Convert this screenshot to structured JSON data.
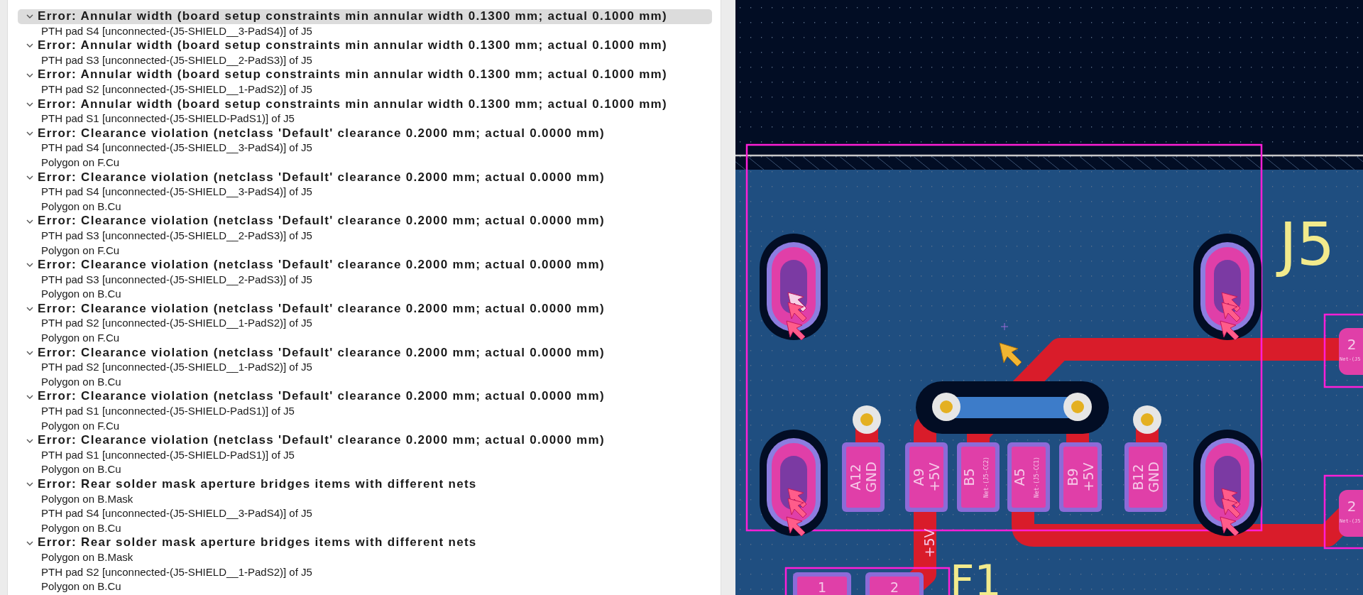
{
  "violations": [
    {
      "title": "Error: Annular width (board setup constraints min annular width 0.1300 mm; actual 0.1000 mm)",
      "expanded": true,
      "selected": true,
      "items": [
        "PTH pad S4 [unconnected-(J5-SHIELD__3-PadS4)] of J5"
      ]
    },
    {
      "title": "Error: Annular width (board setup constraints min annular width 0.1300 mm; actual 0.1000 mm)",
      "expanded": true,
      "selected": false,
      "items": [
        "PTH pad S3 [unconnected-(J5-SHIELD__2-PadS3)] of J5"
      ]
    },
    {
      "title": "Error: Annular width (board setup constraints min annular width 0.1300 mm; actual 0.1000 mm)",
      "expanded": true,
      "selected": false,
      "items": [
        "PTH pad S2 [unconnected-(J5-SHIELD__1-PadS2)] of J5"
      ]
    },
    {
      "title": "Error: Annular width (board setup constraints min annular width 0.1300 mm; actual 0.1000 mm)",
      "expanded": true,
      "selected": false,
      "items": [
        "PTH pad S1 [unconnected-(J5-SHIELD-PadS1)] of J5"
      ]
    },
    {
      "title": "Error: Clearance violation (netclass 'Default' clearance 0.2000 mm; actual 0.0000 mm)",
      "expanded": true,
      "selected": false,
      "items": [
        "PTH pad S4 [unconnected-(J5-SHIELD__3-PadS4)] of J5",
        "Polygon on F.Cu"
      ]
    },
    {
      "title": "Error: Clearance violation (netclass 'Default' clearance 0.2000 mm; actual 0.0000 mm)",
      "expanded": true,
      "selected": false,
      "items": [
        "PTH pad S4 [unconnected-(J5-SHIELD__3-PadS4)] of J5",
        "Polygon on B.Cu"
      ]
    },
    {
      "title": "Error: Clearance violation (netclass 'Default' clearance 0.2000 mm; actual 0.0000 mm)",
      "expanded": true,
      "selected": false,
      "items": [
        "PTH pad S3 [unconnected-(J5-SHIELD__2-PadS3)] of J5",
        "Polygon on F.Cu"
      ]
    },
    {
      "title": "Error: Clearance violation (netclass 'Default' clearance 0.2000 mm; actual 0.0000 mm)",
      "expanded": true,
      "selected": false,
      "items": [
        "PTH pad S3 [unconnected-(J5-SHIELD__2-PadS3)] of J5",
        "Polygon on B.Cu"
      ]
    },
    {
      "title": "Error: Clearance violation (netclass 'Default' clearance 0.2000 mm; actual 0.0000 mm)",
      "expanded": true,
      "selected": false,
      "items": [
        "PTH pad S2 [unconnected-(J5-SHIELD__1-PadS2)] of J5",
        "Polygon on F.Cu"
      ]
    },
    {
      "title": "Error: Clearance violation (netclass 'Default' clearance 0.2000 mm; actual 0.0000 mm)",
      "expanded": true,
      "selected": false,
      "items": [
        "PTH pad S2 [unconnected-(J5-SHIELD__1-PadS2)] of J5",
        "Polygon on B.Cu"
      ]
    },
    {
      "title": "Error: Clearance violation (netclass 'Default' clearance 0.2000 mm; actual 0.0000 mm)",
      "expanded": true,
      "selected": false,
      "items": [
        "PTH pad S1 [unconnected-(J5-SHIELD-PadS1)] of J5",
        "Polygon on F.Cu"
      ]
    },
    {
      "title": "Error: Clearance violation (netclass 'Default' clearance 0.2000 mm; actual 0.0000 mm)",
      "expanded": true,
      "selected": false,
      "items": [
        "PTH pad S1 [unconnected-(J5-SHIELD-PadS1)] of J5",
        "Polygon on B.Cu"
      ]
    },
    {
      "title": "Error: Rear solder mask aperture bridges items with different nets",
      "expanded": true,
      "selected": false,
      "items": [
        "Polygon on B.Mask",
        "PTH pad S4 [unconnected-(J5-SHIELD__3-PadS4)] of J5",
        "Polygon on B.Cu"
      ]
    },
    {
      "title": "Error: Rear solder mask aperture bridges items with different nets",
      "expanded": true,
      "selected": false,
      "items": [
        "Polygon on B.Mask",
        "PTH pad S2 [unconnected-(J5-SHIELD__1-PadS2)] of J5",
        "Polygon on B.Cu"
      ]
    }
  ],
  "pcb": {
    "reference": "J5",
    "second_reference": "F1",
    "trace_label": "+5V",
    "pads": [
      {
        "name": "A12",
        "net": "GND",
        "kind": "power"
      },
      {
        "name": "A9",
        "net": "+5V",
        "kind": "power"
      },
      {
        "name": "B5",
        "net": "Net-(J5-CC2)",
        "kind": "signal"
      },
      {
        "name": "A5",
        "net": "Net-(J5-CC1)",
        "kind": "signal"
      },
      {
        "name": "B9",
        "net": "+5V",
        "kind": "power"
      },
      {
        "name": "B12",
        "net": "GND",
        "kind": "power"
      }
    ],
    "side_pads": [
      {
        "name": "2",
        "net": "Net-(J5"
      },
      {
        "name": "2",
        "net": "Net-(J5"
      }
    ],
    "bottom_pads": [
      "1",
      "2"
    ]
  }
}
